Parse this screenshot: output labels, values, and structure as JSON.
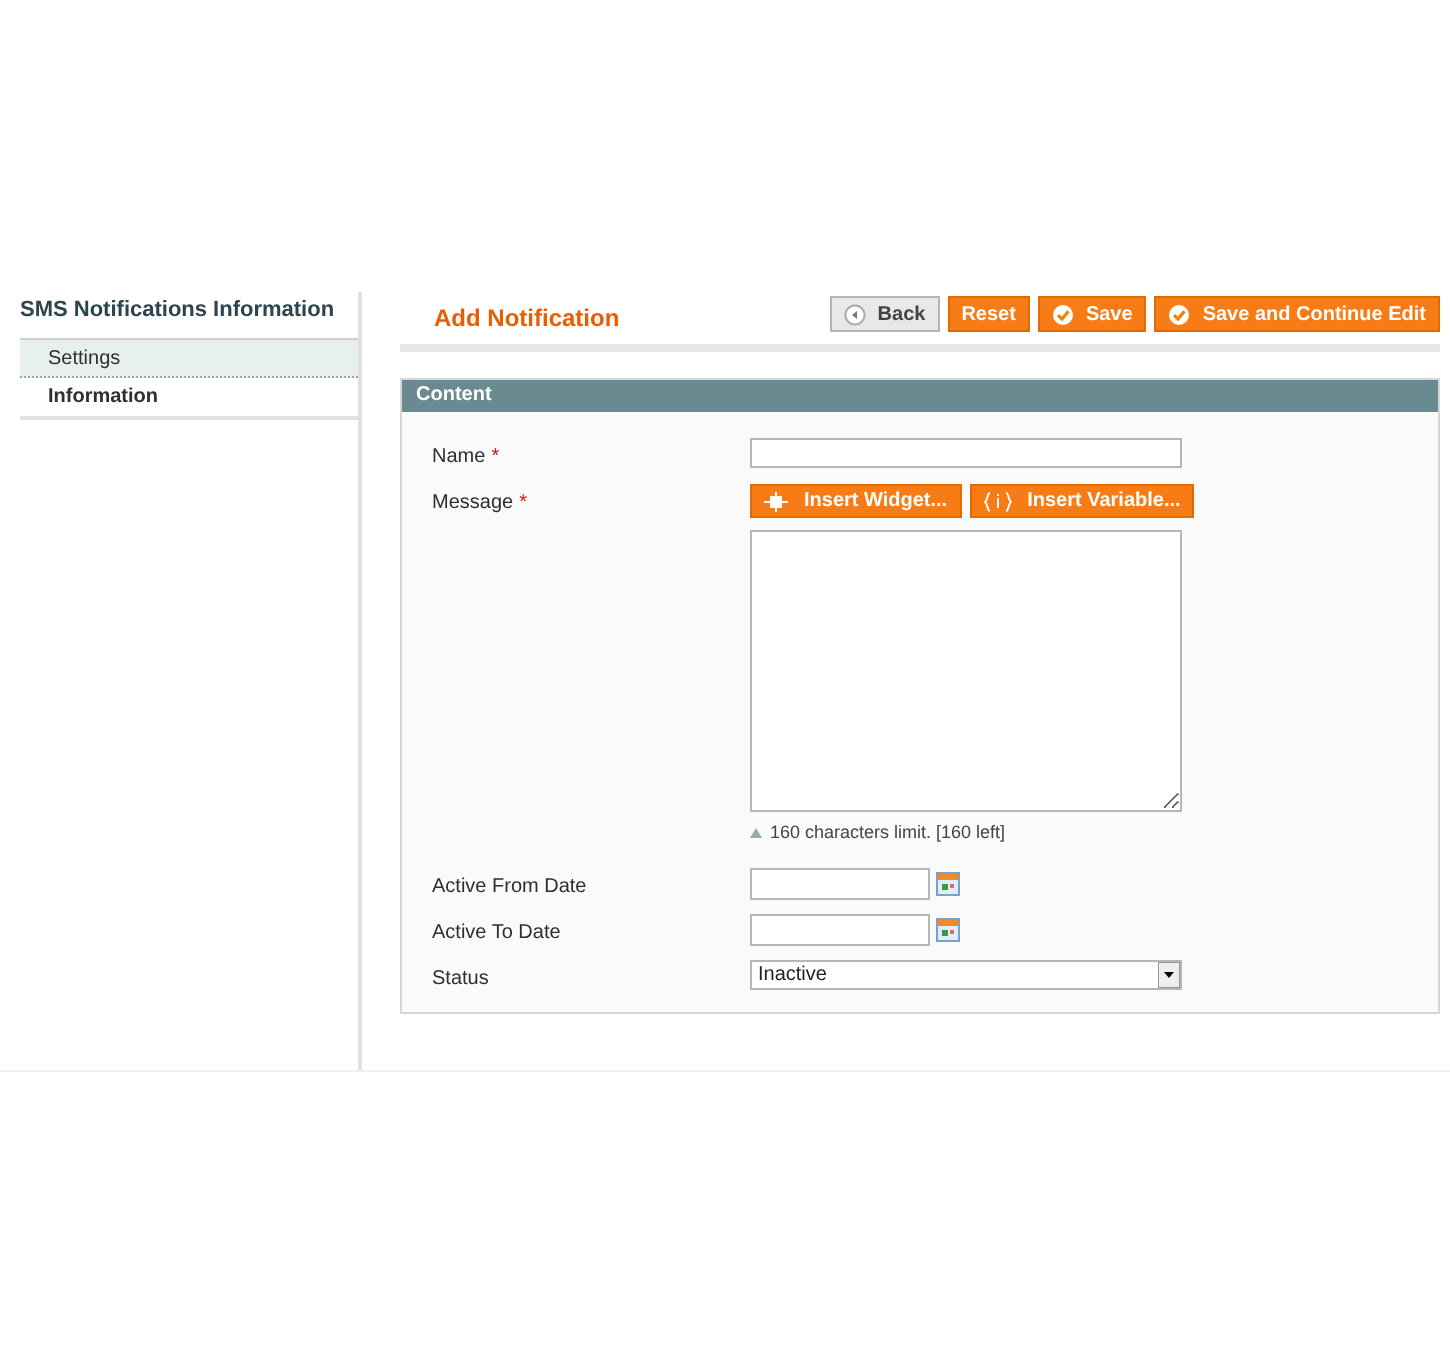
{
  "sidebar": {
    "title": "SMS Notifications Information",
    "items": [
      {
        "label": "Settings",
        "selected": false
      },
      {
        "label": "Information",
        "selected": true
      }
    ]
  },
  "header": {
    "title": "Add Notification",
    "buttons": [
      {
        "label": "Back",
        "kind": "back"
      },
      {
        "label": "Reset",
        "kind": "plain"
      },
      {
        "label": "Save",
        "kind": "check"
      },
      {
        "label": "Save and Continue Edit",
        "kind": "check"
      }
    ]
  },
  "section": {
    "title": "Content",
    "fields": [
      {
        "kind": "text",
        "label": "Name",
        "required_mark": "*"
      },
      {
        "kind": "editor",
        "label": "Message",
        "required_mark": "*",
        "buttons": [
          {
            "label": "Insert Widget...",
            "kind": "widget"
          },
          {
            "label": "Insert Variable...",
            "kind": "variable"
          }
        ],
        "note": "160 characters limit. [160 left]"
      },
      {
        "kind": "date",
        "label": "Active From Date"
      },
      {
        "kind": "date",
        "label": "Active To Date"
      },
      {
        "kind": "select",
        "label": "Status",
        "value": "Inactive"
      }
    ]
  }
}
